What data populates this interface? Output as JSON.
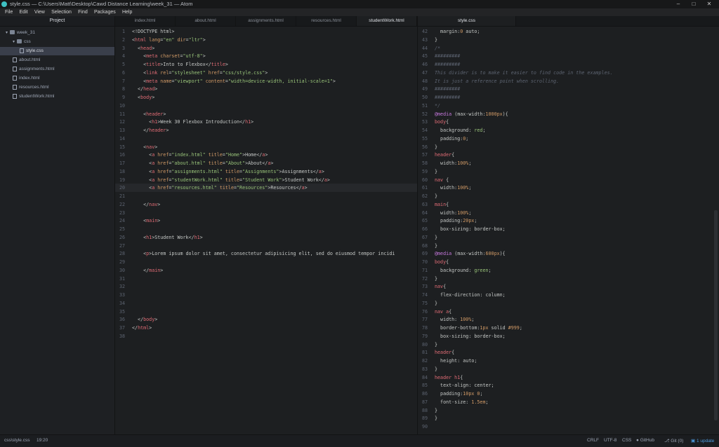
{
  "window": {
    "title": "style.css — C:\\Users\\Matt\\Desktop\\Cawd Distance Learning\\week_31 — Atom",
    "controls": [
      "–",
      "□",
      "✕"
    ]
  },
  "menu": [
    "File",
    "Edit",
    "View",
    "Selection",
    "Find",
    "Packages",
    "Help"
  ],
  "sidebar": {
    "header": "Project",
    "tree": [
      {
        "label": "week_31",
        "type": "folder",
        "depth": 0,
        "open": true
      },
      {
        "label": "css",
        "type": "folder",
        "depth": 1,
        "open": true
      },
      {
        "label": "style.css",
        "type": "file",
        "depth": 2,
        "selected": true
      },
      {
        "label": "about.html",
        "type": "file",
        "depth": 1
      },
      {
        "label": "assignments.html",
        "type": "file",
        "depth": 1
      },
      {
        "label": "index.html",
        "type": "file",
        "depth": 1
      },
      {
        "label": "resources.html",
        "type": "file",
        "depth": 1
      },
      {
        "label": "studentWork.html",
        "type": "file",
        "depth": 1
      }
    ]
  },
  "left_pane": {
    "tabs": [
      "index.html",
      "about.html",
      "assignments.html",
      "resources.html",
      "studentWork.html"
    ],
    "active_tab": 4,
    "cursor_line": 20,
    "lines": [
      [
        [
          "p",
          "<!DOCTYPE html>"
        ]
      ],
      [
        [
          "p",
          "<"
        ],
        [
          "t",
          "html"
        ],
        [
          "a",
          " lang"
        ],
        [
          "p",
          "="
        ],
        [
          "s",
          "\"en\""
        ],
        [
          "a",
          " dir"
        ],
        [
          "p",
          "="
        ],
        [
          "s",
          "\"ltr\""
        ],
        [
          "p",
          ">"
        ]
      ],
      [
        [
          "p",
          "  <"
        ],
        [
          "t",
          "head"
        ],
        [
          "p",
          ">"
        ]
      ],
      [
        [
          "p",
          "    <"
        ],
        [
          "t",
          "meta"
        ],
        [
          "a",
          " charset"
        ],
        [
          "p",
          "="
        ],
        [
          "s",
          "\"utf-8\""
        ],
        [
          "p",
          ">"
        ]
      ],
      [
        [
          "p",
          "    <"
        ],
        [
          "t",
          "title"
        ],
        [
          "p",
          ">Into to Flexbox</"
        ],
        [
          "t",
          "title"
        ],
        [
          "p",
          ">"
        ]
      ],
      [
        [
          "p",
          "    <"
        ],
        [
          "t",
          "link"
        ],
        [
          "a",
          " rel"
        ],
        [
          "p",
          "="
        ],
        [
          "s",
          "\"stylesheet\""
        ],
        [
          "a",
          " href"
        ],
        [
          "p",
          "="
        ],
        [
          "s",
          "\"css/style.css\""
        ],
        [
          "p",
          ">"
        ]
      ],
      [
        [
          "p",
          "    <"
        ],
        [
          "t",
          "meta"
        ],
        [
          "a",
          " name"
        ],
        [
          "p",
          "="
        ],
        [
          "s",
          "\"viewport\""
        ],
        [
          "a",
          " content"
        ],
        [
          "p",
          "="
        ],
        [
          "s",
          "\"width=device-width, initial-scale=1\""
        ],
        [
          "p",
          ">"
        ]
      ],
      [
        [
          "p",
          "  </"
        ],
        [
          "t",
          "head"
        ],
        [
          "p",
          ">"
        ]
      ],
      [
        [
          "p",
          "  <"
        ],
        [
          "t",
          "body"
        ],
        [
          "p",
          ">"
        ]
      ],
      [],
      [
        [
          "p",
          "    <"
        ],
        [
          "t",
          "header"
        ],
        [
          "p",
          ">"
        ]
      ],
      [
        [
          "p",
          "      <"
        ],
        [
          "t",
          "h1"
        ],
        [
          "p",
          ">Week 30 Flexbox Introduction</"
        ],
        [
          "t",
          "h1"
        ],
        [
          "p",
          ">"
        ]
      ],
      [
        [
          "p",
          "    </"
        ],
        [
          "t",
          "header"
        ],
        [
          "p",
          ">"
        ]
      ],
      [],
      [
        [
          "p",
          "    <"
        ],
        [
          "t",
          "nav"
        ],
        [
          "p",
          ">"
        ]
      ],
      [
        [
          "p",
          "      <"
        ],
        [
          "t",
          "a"
        ],
        [
          "a",
          " href"
        ],
        [
          "p",
          "="
        ],
        [
          "s",
          "\"index.html\""
        ],
        [
          "a",
          " title"
        ],
        [
          "p",
          "="
        ],
        [
          "s",
          "\"Home\""
        ],
        [
          "p",
          ">Home</"
        ],
        [
          "t",
          "a"
        ],
        [
          "p",
          ">"
        ]
      ],
      [
        [
          "p",
          "      <"
        ],
        [
          "t",
          "a"
        ],
        [
          "a",
          " href"
        ],
        [
          "p",
          "="
        ],
        [
          "s",
          "\"about.html\""
        ],
        [
          "a",
          " title"
        ],
        [
          "p",
          "="
        ],
        [
          "s",
          "\"About\""
        ],
        [
          "p",
          ">About</"
        ],
        [
          "t",
          "a"
        ],
        [
          "p",
          ">"
        ]
      ],
      [
        [
          "p",
          "      <"
        ],
        [
          "t",
          "a"
        ],
        [
          "a",
          " href"
        ],
        [
          "p",
          "="
        ],
        [
          "s",
          "\"assignments.html\""
        ],
        [
          "a",
          " title"
        ],
        [
          "p",
          "="
        ],
        [
          "s",
          "\"Assignments\""
        ],
        [
          "p",
          ">Assignments</"
        ],
        [
          "t",
          "a"
        ],
        [
          "p",
          ">"
        ]
      ],
      [
        [
          "p",
          "      <"
        ],
        [
          "t",
          "a"
        ],
        [
          "a",
          " href"
        ],
        [
          "p",
          "="
        ],
        [
          "s",
          "\"studentWork.html\""
        ],
        [
          "a",
          " title"
        ],
        [
          "p",
          "="
        ],
        [
          "s",
          "\"Student Work\""
        ],
        [
          "p",
          ">Student Work</"
        ],
        [
          "t",
          "a"
        ],
        [
          "p",
          ">"
        ]
      ],
      [
        [
          "p",
          "      <"
        ],
        [
          "t",
          "a"
        ],
        [
          "a",
          " href"
        ],
        [
          "p",
          "="
        ],
        [
          "s",
          "\"resources.html\""
        ],
        [
          "a",
          " title"
        ],
        [
          "p",
          "="
        ],
        [
          "s",
          "\"Resources\""
        ],
        [
          "p",
          ">Resources</"
        ],
        [
          "t",
          "a"
        ],
        [
          "p",
          ">"
        ]
      ],
      [],
      [
        [
          "p",
          "    </"
        ],
        [
          "t",
          "nav"
        ],
        [
          "p",
          ">"
        ]
      ],
      [],
      [
        [
          "p",
          "    <"
        ],
        [
          "t",
          "main"
        ],
        [
          "p",
          ">"
        ]
      ],
      [],
      [
        [
          "p",
          "    <"
        ],
        [
          "t",
          "h1"
        ],
        [
          "p",
          ">Student Work</"
        ],
        [
          "t",
          "h1"
        ],
        [
          "p",
          ">"
        ]
      ],
      [],
      [
        [
          "p",
          "    <"
        ],
        [
          "t",
          "p"
        ],
        [
          "p",
          ">Lorem ipsum dolor sit amet, consectetur adipisicing elit, sed do eiusmod tempor incidi"
        ]
      ],
      [],
      [
        [
          "p",
          "    </"
        ],
        [
          "t",
          "main"
        ],
        [
          "p",
          ">"
        ]
      ],
      [],
      [],
      [],
      [],
      [],
      [
        [
          "p",
          "  </"
        ],
        [
          "t",
          "body"
        ],
        [
          "p",
          ">"
        ]
      ],
      [
        [
          "p",
          "</"
        ],
        [
          "t",
          "html"
        ],
        [
          "p",
          ">"
        ]
      ],
      []
    ]
  },
  "right_pane": {
    "tabs": [
      "style.css"
    ],
    "active_tab": 0,
    "first_line": 42,
    "lines": [
      [
        [
          "p",
          "  margin"
        ],
        [
          "p",
          ":"
        ],
        [
          "n",
          "0"
        ],
        [
          "p",
          " auto;"
        ]
      ],
      [
        [
          "p",
          "}"
        ]
      ],
      [
        [
          "c",
          "/*"
        ]
      ],
      [
        [
          "c",
          "#########"
        ]
      ],
      [
        [
          "c",
          "#########"
        ]
      ],
      [
        [
          "c",
          "This divider is to make it easier to find code in the examples."
        ]
      ],
      [
        [
          "c",
          "It is just a reference point when scrolling."
        ]
      ],
      [
        [
          "c",
          "#########"
        ]
      ],
      [
        [
          "c",
          "#########"
        ]
      ],
      [
        [
          "c",
          "*/"
        ]
      ],
      [
        [
          "at",
          "@media"
        ],
        [
          "p",
          " (max-width:"
        ],
        [
          "n",
          "1000px"
        ],
        [
          "p",
          "){"
        ]
      ],
      [
        [
          "t",
          "body"
        ],
        [
          "p",
          "{"
        ]
      ],
      [
        [
          "p",
          "  background: "
        ],
        [
          "v",
          "red"
        ],
        [
          "p",
          ";"
        ]
      ],
      [
        [
          "p",
          "  padding:"
        ],
        [
          "n",
          "0"
        ],
        [
          "p",
          ";"
        ]
      ],
      [
        [
          "p",
          "}"
        ]
      ],
      [
        [
          "t",
          "header"
        ],
        [
          "p",
          "{"
        ]
      ],
      [
        [
          "p",
          "  width:"
        ],
        [
          "n",
          "100%"
        ],
        [
          "p",
          ";"
        ]
      ],
      [
        [
          "p",
          "}"
        ]
      ],
      [
        [
          "t",
          "nav"
        ],
        [
          "p",
          " {"
        ]
      ],
      [
        [
          "p",
          "  width:"
        ],
        [
          "n",
          "100%"
        ],
        [
          "p",
          ";"
        ]
      ],
      [
        [
          "p",
          "}"
        ]
      ],
      [
        [
          "t",
          "main"
        ],
        [
          "p",
          "{"
        ]
      ],
      [
        [
          "p",
          "  width:"
        ],
        [
          "n",
          "100%"
        ],
        [
          "p",
          ";"
        ]
      ],
      [
        [
          "p",
          "  padding:"
        ],
        [
          "n",
          "20px"
        ],
        [
          "p",
          ";"
        ]
      ],
      [
        [
          "p",
          "  box-sizing: border-box;"
        ]
      ],
      [
        [
          "p",
          "}"
        ]
      ],
      [
        [
          "p",
          "}"
        ]
      ],
      [
        [
          "at",
          "@media"
        ],
        [
          "p",
          " (max-width:"
        ],
        [
          "n",
          "600px"
        ],
        [
          "p",
          "){"
        ]
      ],
      [
        [
          "t",
          "body"
        ],
        [
          "p",
          "{"
        ]
      ],
      [
        [
          "p",
          "  background: "
        ],
        [
          "v",
          "green"
        ],
        [
          "p",
          ";"
        ]
      ],
      [
        [
          "p",
          "}"
        ]
      ],
      [
        [
          "t",
          "nav"
        ],
        [
          "p",
          "{"
        ]
      ],
      [
        [
          "p",
          "  flex-direction: column;"
        ]
      ],
      [
        [
          "p",
          "}"
        ]
      ],
      [
        [
          "t",
          "nav a"
        ],
        [
          "p",
          "{"
        ]
      ],
      [
        [
          "p",
          "  width: "
        ],
        [
          "n",
          "100%"
        ],
        [
          "p",
          ";"
        ]
      ],
      [
        [
          "p",
          "  border-bottom:"
        ],
        [
          "n",
          "1px"
        ],
        [
          "p",
          " solid "
        ],
        [
          "n",
          "#999"
        ],
        [
          "p",
          ";"
        ]
      ],
      [
        [
          "p",
          "  box-sizing: border-box;"
        ]
      ],
      [
        [
          "p",
          "}"
        ]
      ],
      [
        [
          "t",
          "header"
        ],
        [
          "p",
          "{"
        ]
      ],
      [
        [
          "p",
          "  height: auto;"
        ]
      ],
      [
        [
          "p",
          "}"
        ]
      ],
      [
        [
          "t",
          "header h1"
        ],
        [
          "p",
          "{"
        ]
      ],
      [
        [
          "p",
          "  text-align: center;"
        ]
      ],
      [
        [
          "p",
          "  padding:"
        ],
        [
          "n",
          "10px 0"
        ],
        [
          "p",
          ";"
        ]
      ],
      [
        [
          "p",
          "  font-size: "
        ],
        [
          "n",
          "1.5em"
        ],
        [
          "p",
          ";"
        ]
      ],
      [
        [
          "p",
          "}"
        ]
      ],
      [
        [
          "p",
          "}"
        ]
      ],
      []
    ]
  },
  "status": {
    "path": "css\\style.css",
    "cursor": "19:20",
    "line_ending": "CRLF",
    "encoding": "UTF-8",
    "grammar": "CSS",
    "github": "GitHub",
    "git": "Git (0)",
    "update": "1 update"
  }
}
